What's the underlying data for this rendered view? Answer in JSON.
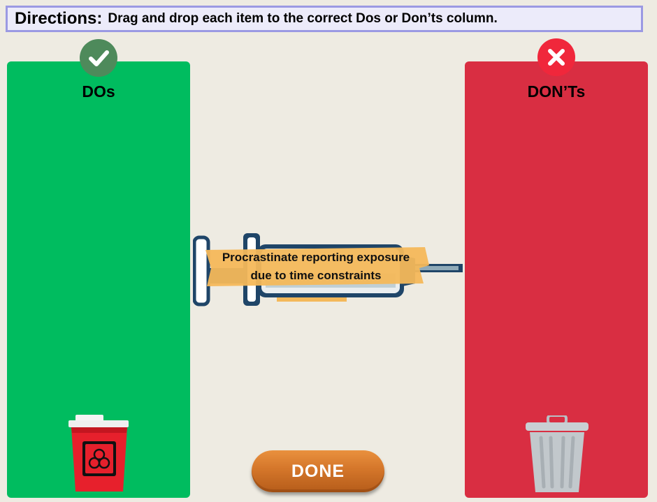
{
  "directions": {
    "label": "Directions:",
    "text": "Drag and drop each item to the correct Dos or Don’ts column."
  },
  "columns": {
    "dos": {
      "title": "DOs",
      "color": "#00bc5f",
      "icon": "check-icon",
      "bin_icon": "sharps-container-icon"
    },
    "donts": {
      "title": "DON’Ts",
      "color": "#d92e42",
      "icon": "x-icon",
      "bin_icon": "trash-can-icon"
    }
  },
  "drag_item": {
    "line1": "Procrastinate reporting exposure",
    "line2": "due to time constraints",
    "icon": "syringe-icon"
  },
  "done_button": {
    "label": "DONE"
  },
  "colors": {
    "background": "#eeebe2",
    "directions_border": "#9b99e3",
    "done_orange": "#d4762a"
  }
}
